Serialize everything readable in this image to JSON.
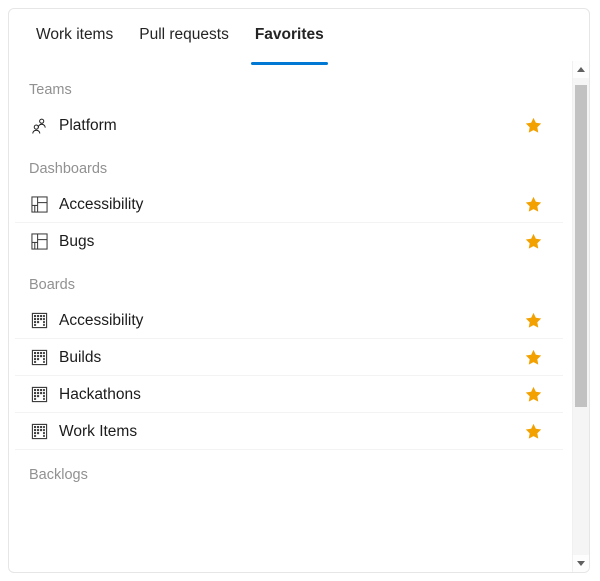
{
  "tabs": [
    {
      "label": "Work items",
      "selected": false
    },
    {
      "label": "Pull requests",
      "selected": false
    },
    {
      "label": "Favorites",
      "selected": true
    }
  ],
  "colors": {
    "accent": "#0078d4",
    "star": "#f2a100",
    "section_header": "#919191",
    "label": "#1b1b1b",
    "separator": "#f3f3f3",
    "panel_border": "#e6e6e6",
    "scroll_thumb": "#c2c2c2"
  },
  "sections": [
    {
      "title": "Teams",
      "items": [
        {
          "label": "Platform",
          "icon": "team-people-icon",
          "starred": true
        }
      ]
    },
    {
      "title": "Dashboards",
      "items": [
        {
          "label": "Accessibility",
          "icon": "dashboard-tiles-icon",
          "starred": true
        },
        {
          "label": "Bugs",
          "icon": "dashboard-tiles-icon",
          "starred": true
        }
      ]
    },
    {
      "title": "Boards",
      "items": [
        {
          "label": "Accessibility",
          "icon": "board-kanban-icon",
          "starred": true
        },
        {
          "label": "Builds",
          "icon": "board-kanban-icon",
          "starred": true
        },
        {
          "label": "Hackathons",
          "icon": "board-kanban-icon",
          "starred": true
        },
        {
          "label": "Work Items",
          "icon": "board-kanban-icon",
          "starred": true
        }
      ]
    },
    {
      "title": "Backlogs",
      "items": []
    }
  ],
  "scrollbar": {
    "up_arrow": "scroll-up-arrow-icon",
    "down_arrow": "scroll-down-arrow-icon"
  }
}
